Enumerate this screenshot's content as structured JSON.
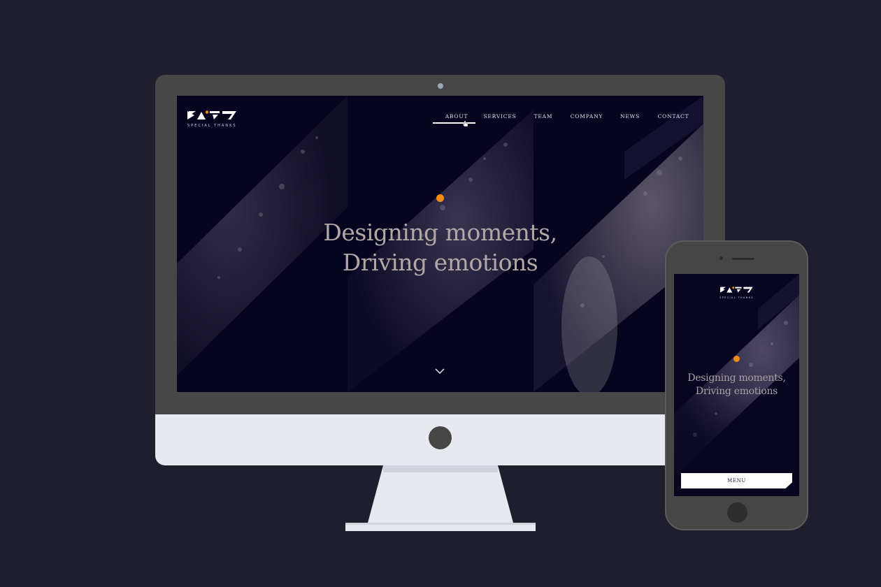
{
  "desktop": {
    "logo_text": "SPECIAL  THANKS",
    "nav": [
      {
        "label": "ABOUT",
        "active": true
      },
      {
        "label": "SERVICES",
        "active": false
      },
      {
        "label": "TEAM",
        "active": false
      },
      {
        "label": "COMPANY",
        "active": false
      },
      {
        "label": "NEWS",
        "active": false
      },
      {
        "label": "CONTACT",
        "active": false
      }
    ],
    "hero": {
      "line1": "Designing moments,",
      "line2": "Driving emotions"
    },
    "accent_color": "#f28a16",
    "scroll_icon": "chevron-down-icon"
  },
  "mobile": {
    "logo_text": "SPECIAL  THANKS",
    "hero": {
      "line1": "Designing moments,",
      "line2": "Driving emotions"
    },
    "menu_label": "MENU"
  }
}
